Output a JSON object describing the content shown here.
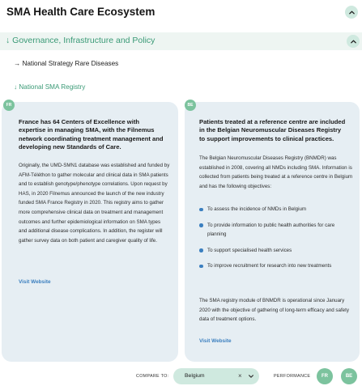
{
  "header": {
    "title": "SMA Health Care Ecosystem",
    "collapse_icon": "chevron-up-icon"
  },
  "section": {
    "title": "Governance, Infrastructure and Policy",
    "arrow": "↓",
    "collapse_icon": "chevron-up-icon"
  },
  "subitems": [
    {
      "label": "National Strategy Rare Diseases",
      "arrow": "→"
    },
    {
      "label": "National SMA Registry",
      "arrow": "↓"
    }
  ],
  "cards": {
    "fr": {
      "badge": "FR",
      "heading": "France has 64 Centers of Excellence with expertise in managing SMA, with the Filnemus network coordinating treatment management and developing new Standards of Care.",
      "body": "Originally, the UMD-SMN1 database was established and funded by AFM-Téléthon to gather molecular and clinical data in SMA patients and to establish genotype/phenotype correlations. Upon request by HAS, in 2020 Filnemus announced the launch of the new industry funded SMA France Registry in 2020. This registry aims to gather more comprehensive clinical data on treatment and management outcomes and further epidemiological information on SMA types and additional disease complications. In addition, the register will gather survey data on both patient and caregiver quality of life.",
      "link": "Visit Website"
    },
    "be": {
      "badge": "BE",
      "heading": "Patients treated at a reference centre are included in the Belgian Neuromuscular Diseases Registry to support improvements to clinical practices.",
      "body": "The Belgian Neuromuscular Diseases Registry (BNMDR) was established in 2008, covering all NMDs including SMA. Information is collected from patients being treated at a reference centre in Belgium and has the following objectives:",
      "bullets": [
        "To assess the incidence of NMDs in Belgium",
        "To provide information to public health authorities for care planning",
        "To support specialised health services",
        "To improve recruitment for research into new treatments"
      ],
      "closing": "The SMA registry module of BNMDR is operational since January 2020 with the objective of gathering of long-term efficacy and safety data of treatment options.",
      "link": "Visit Website"
    }
  },
  "footer": {
    "compare_label": "COMPARE TO:",
    "compare_value": "Belgium",
    "clear_symbol": "×",
    "performance_label": "PERFORMANCE",
    "badges": [
      "FR",
      "BE"
    ]
  },
  "colors": {
    "accent_green": "#3a9a76",
    "badge_green": "#7cc39e",
    "pale_green": "#cfe9df",
    "card_bg": "#e6eef3",
    "link_blue": "#3b7fbf"
  }
}
